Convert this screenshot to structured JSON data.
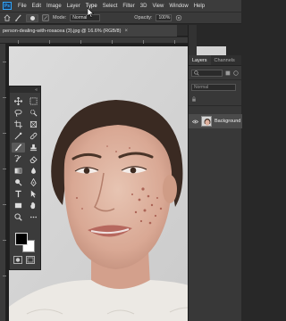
{
  "menubar": {
    "app_logo": "Ps",
    "items": [
      "File",
      "Edit",
      "Image",
      "Layer",
      "Type",
      "Select",
      "Filter",
      "3D",
      "View",
      "Window",
      "Help"
    ]
  },
  "options_bar": {
    "home_icon": "home-icon",
    "mode_label": "Mode:",
    "mode_value": "Normal",
    "opacity_label": "Opacity:",
    "opacity_value": "100%"
  },
  "document": {
    "tab_title": "person-dealing-with-rosacea (3).jpg @ 16.6% (RGB/8)",
    "close_glyph": "×"
  },
  "toolbar": {
    "collapse_glyph": "«",
    "foreground_color": "#000000",
    "background_color": "#ffffff"
  },
  "layers_panel": {
    "tabs": [
      "Layers",
      "Channels"
    ],
    "blend_mode": "Normal",
    "layer_name": "Background"
  },
  "colors": {
    "accent": "#31a8ff",
    "canvas_bg": "#d4d4d4"
  }
}
